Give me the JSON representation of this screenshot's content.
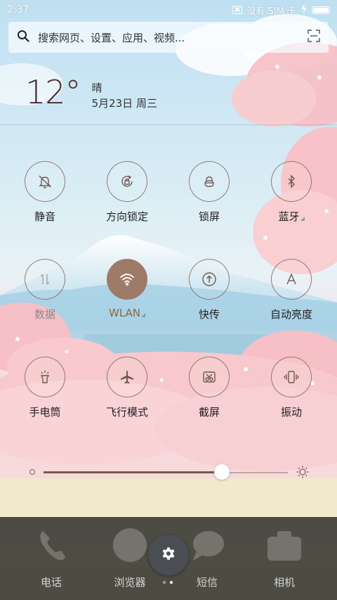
{
  "status_bar": {
    "time": "2:37",
    "carrier_text": "没有 SIM 卡"
  },
  "search": {
    "placeholder": "搜索网页、设置、应用、视频..."
  },
  "weather": {
    "temperature": "12°",
    "condition": "晴",
    "date": "5月23日 周三"
  },
  "toggles": [
    {
      "label": "静音",
      "icon": "bell-off-icon",
      "active": false
    },
    {
      "label": "方向锁定",
      "icon": "rotation-lock-icon",
      "active": false
    },
    {
      "label": "锁屏",
      "icon": "lock-icon",
      "active": false
    },
    {
      "label": "蓝牙",
      "icon": "bluetooth-icon",
      "active": false
    },
    {
      "label": "数据",
      "icon": "mobile-data-icon",
      "active": false
    },
    {
      "label": "WLAN",
      "icon": "wifi-icon",
      "active": true
    },
    {
      "label": "快传",
      "icon": "quick-transfer-icon",
      "active": false
    },
    {
      "label": "自动亮度",
      "icon": "auto-brightness-icon",
      "active": false
    },
    {
      "label": "手电筒",
      "icon": "flashlight-icon",
      "active": false
    },
    {
      "label": "飞行模式",
      "icon": "airplane-icon",
      "active": false
    },
    {
      "label": "截屏",
      "icon": "screenshot-icon",
      "active": false
    },
    {
      "label": "振动",
      "icon": "vibrate-icon",
      "active": false
    }
  ],
  "brightness": {
    "level": 0.73
  },
  "dock": {
    "apps": [
      {
        "label": "电话",
        "icon": "phone-icon"
      },
      {
        "label": "浏览器",
        "icon": "browser-icon"
      },
      {
        "label": "短信",
        "icon": "messages-icon"
      },
      {
        "label": "相机",
        "icon": "camera-icon"
      }
    ],
    "settings_icon": "gear-icon",
    "page_count": 2,
    "current_page": 2
  },
  "colors": {
    "toggle_active": "#9e7a68",
    "toggle_border": "#82695f",
    "accent_text": "#8a6a3a",
    "dock_bg": "#282a24"
  }
}
